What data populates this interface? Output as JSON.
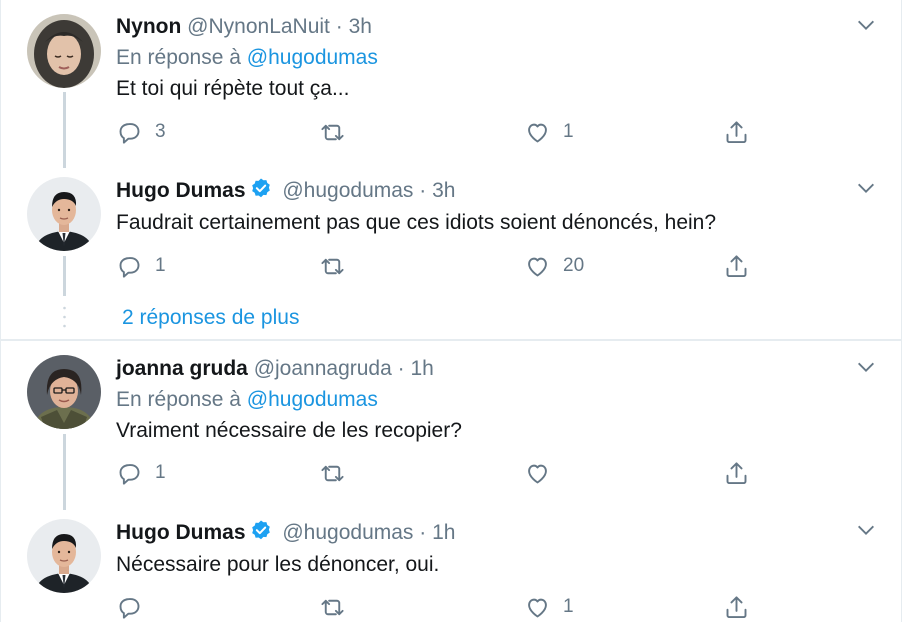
{
  "colors": {
    "link": "#1b95e0",
    "secondary_text": "#657786",
    "verified": "#1da1f2",
    "thread_line": "#ccd6dd"
  },
  "tweets": [
    {
      "name": "Nynon",
      "handle": "@NynonLaNuit",
      "dot": "·",
      "time": "3h",
      "verified": false,
      "reply_prefix": "En réponse à",
      "reply_mention": "@hugodumas",
      "text": "Et toi qui répète tout ça...",
      "replies": "3",
      "retweets": "",
      "likes": "1"
    },
    {
      "name": "Hugo Dumas",
      "handle": "@hugodumas",
      "dot": "·",
      "time": "3h",
      "verified": true,
      "text": "Faudrait certainement pas que ces idiots soient dénoncés, hein?",
      "replies": "1",
      "retweets": "",
      "likes": "20"
    },
    {
      "name": "joanna gruda",
      "handle": "@joannagruda",
      "dot": "·",
      "time": "1h",
      "verified": false,
      "reply_prefix": "En réponse à",
      "reply_mention": "@hugodumas",
      "text": "Vraiment nécessaire de les recopier?",
      "replies": "1",
      "retweets": "",
      "likes": ""
    },
    {
      "name": "Hugo Dumas",
      "handle": "@hugodumas",
      "dot": "·",
      "time": "1h",
      "verified": true,
      "text": "Nécessaire pour les dénoncer, oui.",
      "replies": "",
      "retweets": "",
      "likes": "1"
    }
  ],
  "more_replies_label": "2 réponses de plus",
  "icons": {
    "reply": "reply-icon",
    "retweet": "retweet-icon",
    "like": "heart-icon",
    "share": "share-icon",
    "caret": "chevron-down-icon",
    "verified": "verified-badge-icon"
  }
}
